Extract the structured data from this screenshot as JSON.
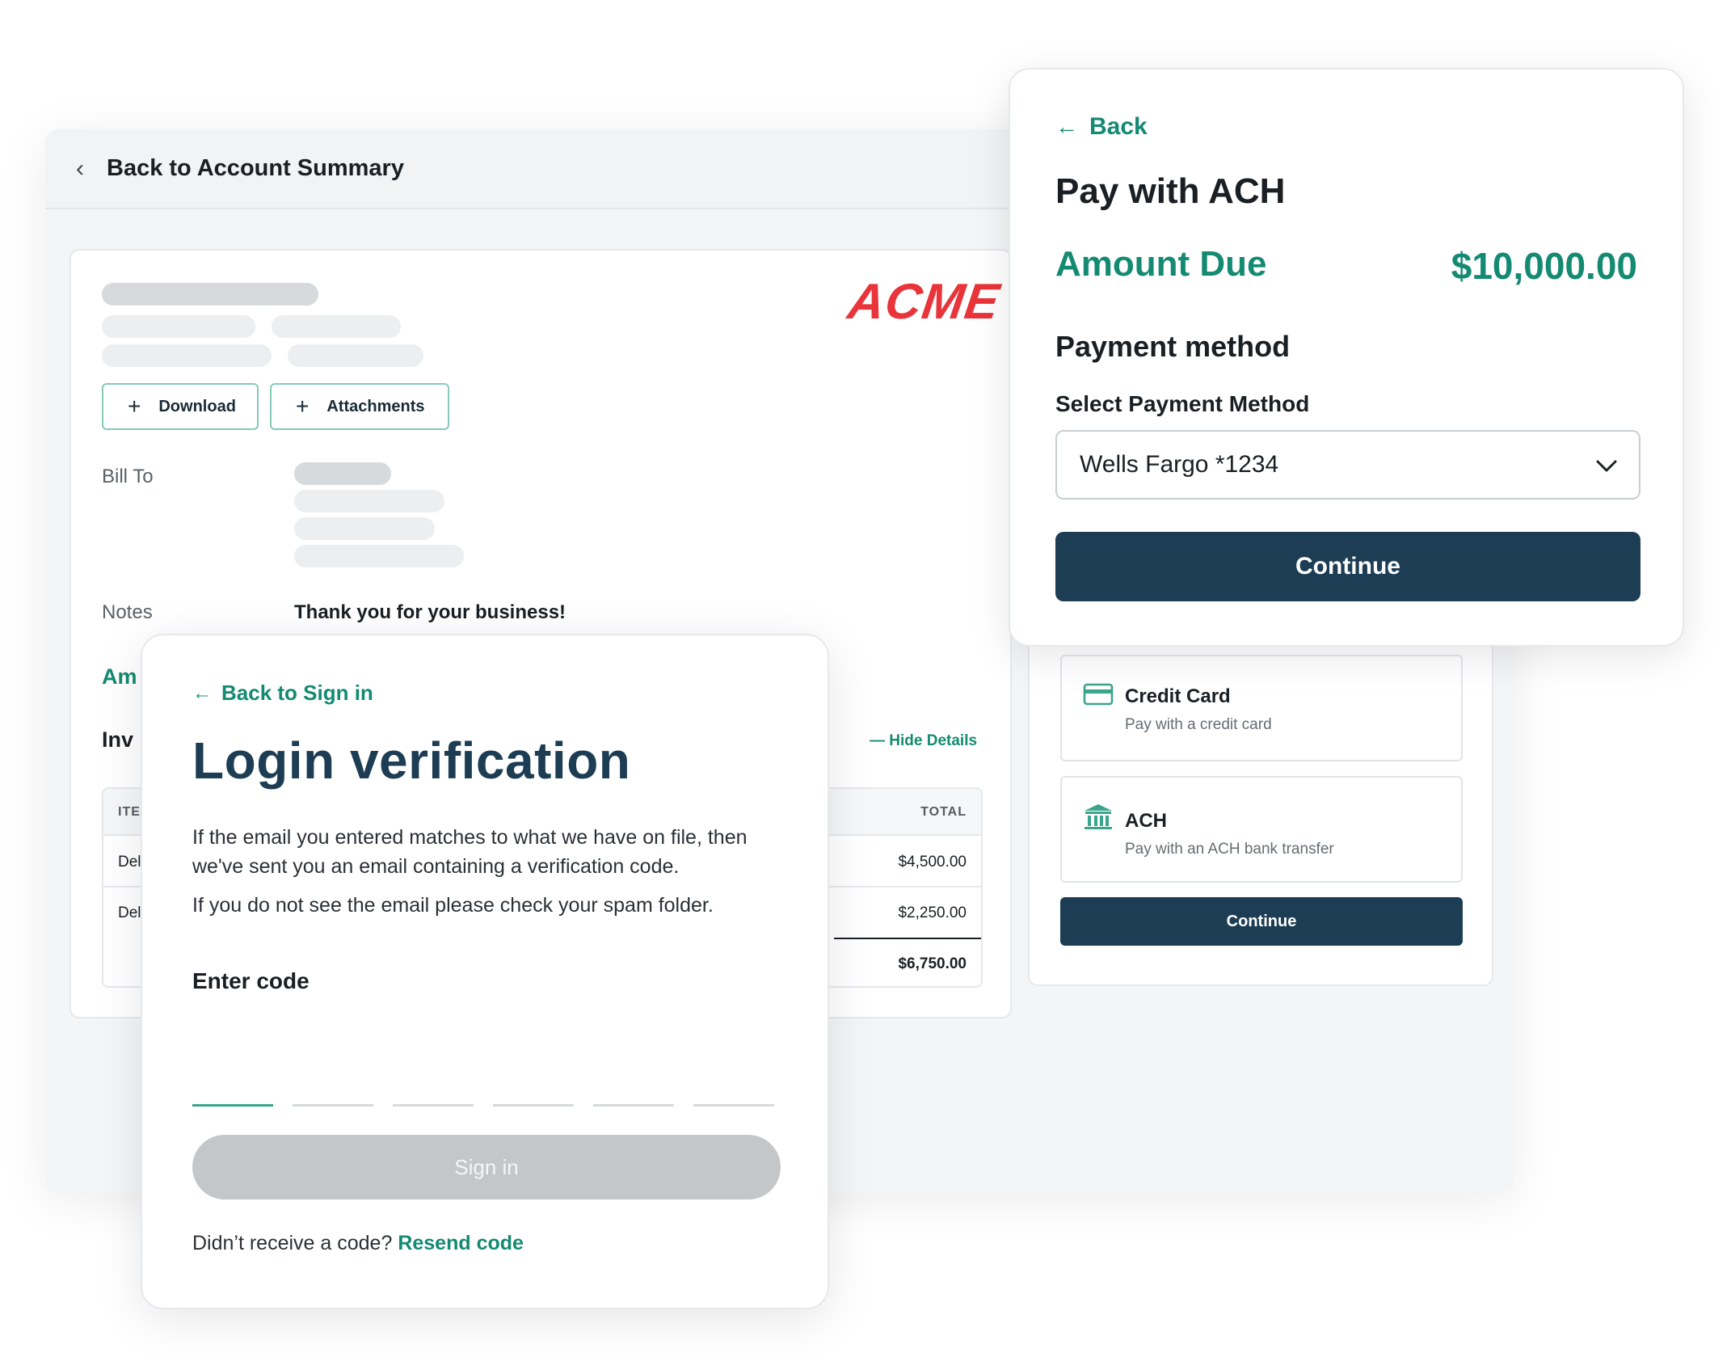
{
  "app": {
    "back_label": "Back to Account Summary"
  },
  "invoice": {
    "logo_text": "ACME",
    "download_label": "Download",
    "attachments_label": "Attachments",
    "bill_to_label": "Bill To",
    "notes_label": "Notes",
    "notes_text": "Thank you for your business!",
    "amount_label_partial": "Am",
    "invoice_label_partial": "Inv",
    "hide_details_label": "Hide Details",
    "table": {
      "col_item_partial": "ITEI",
      "col_total": "TOTAL",
      "rows": [
        {
          "item_partial": "Del",
          "total": "$4,500.00"
        },
        {
          "item_partial": "Del",
          "total": "$2,250.00"
        }
      ],
      "grand_total": "$6,750.00"
    }
  },
  "payment_methods": {
    "options": [
      {
        "title": "Credit Card",
        "subtitle": "Pay with a credit card",
        "icon": "credit-card-icon"
      },
      {
        "title": "ACH",
        "subtitle": "Pay with an ACH bank transfer",
        "icon": "bank-icon"
      }
    ],
    "continue_label": "Continue"
  },
  "ach": {
    "back_label": "Back",
    "title": "Pay with ACH",
    "amount_due_label": "Amount Due",
    "amount_due_value": "$10,000.00",
    "payment_method_heading": "Payment method",
    "select_label": "Select Payment Method",
    "selected_value": "Wells Fargo *1234",
    "continue_label": "Continue"
  },
  "login": {
    "back_label": "Back to Sign in",
    "title": "Login verification",
    "paragraph_1": "If the email you entered matches to what we have on file, then we've sent you an email containing a verification code.",
    "paragraph_2": "If you do not see the email please check your spam folder.",
    "enter_code_label": "Enter code",
    "sign_in_label": "Sign in",
    "resend_prompt": "Didn’t receive a code?",
    "resend_link": "Resend code"
  },
  "colors": {
    "brand_green": "#148a72",
    "navy": "#1d3d54",
    "acme_red": "#e8343a",
    "disabled_gray": "#c4c6c8"
  }
}
